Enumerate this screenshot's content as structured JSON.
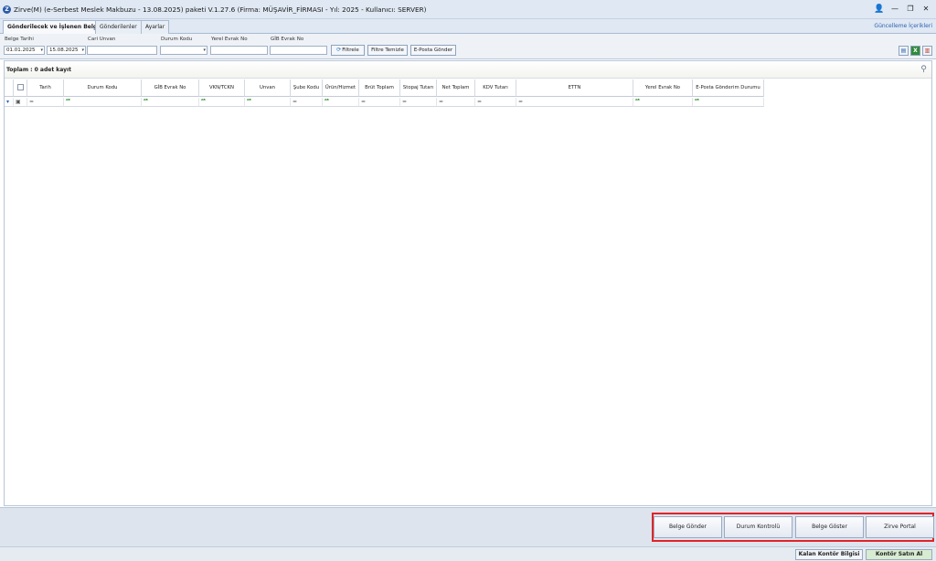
{
  "window": {
    "app_icon": "Z",
    "title": "Zirve(M)  (e-Serbest Meslek Makbuzu - 13.08.2025) paketi V.1.27.6 (Firma: MÜŞAVİR_FİRMASI - Yıl: 2025 - Kullanıcı: SERVER)",
    "controls": {
      "user": "👤",
      "minimize": "—",
      "restore": "❐",
      "close": "✕"
    }
  },
  "tabs": [
    {
      "label": "Gönderilecek ve İşlenen Belgeler",
      "active": true
    },
    {
      "label": "Gönderilenler",
      "active": false
    },
    {
      "label": "Ayarlar",
      "active": false
    }
  ],
  "update_link": "Güncelleme İçerikleri",
  "filters": {
    "belge_tarihi_label": "Belge Tarihi",
    "date_from": "01.01.2025",
    "date_to": "15.08.2025",
    "cari_unvan_label": "Cari Unvan",
    "cari_unvan_value": "",
    "durum_kodu_label": "Durum Kodu",
    "durum_kodu_value": "",
    "yerel_evrak_label": "Yerel Evrak No",
    "yerel_evrak_value": "",
    "gib_evrak_label": "GİB Evrak No",
    "gib_evrak_value": "",
    "filtrele": "Filtrele",
    "filtre_temizle": "Filtre Temizle",
    "eposta_gonder": "E-Posta Gönder",
    "arrow": "▾",
    "refresh_icon_glyph": "⟳"
  },
  "right_tools": {
    "doc_icon": "▤",
    "excel_icon": "X",
    "pdf_icon": "▥"
  },
  "grid": {
    "total": "Toplam : 0 adet kayıt",
    "search_glyph": "⚲",
    "columns": [
      "Tarih",
      "Durum Kodu",
      "GİB Evrak No",
      "VKN/TCKN",
      "Unvan",
      "Şube Kodu",
      "Ürün/Hizmet",
      "Brüt Toplam",
      "Stopaj Tutarı",
      "Net Toplam",
      "KDV Tutarı",
      "ETTN",
      "Yerel Evrak No",
      "E-Posta Gönderim Durumu"
    ],
    "filter_row": {
      "indicator": "▾",
      "sel": "▣",
      "eq": "=",
      "like": "ᴬᴮ",
      "cells": [
        "eq",
        "like",
        "like",
        "like",
        "like",
        "eq",
        "like",
        "eq",
        "eq",
        "eq",
        "eq",
        "eq",
        "like",
        "like"
      ]
    }
  },
  "actions": [
    "Belge Gönder",
    "Durum Kontrolü",
    "Belge Göster",
    "Zirve Portal"
  ],
  "status": {
    "kalan": "Kalan Kontör Bilgisi",
    "satin_al": "Kontör Satın Al"
  }
}
